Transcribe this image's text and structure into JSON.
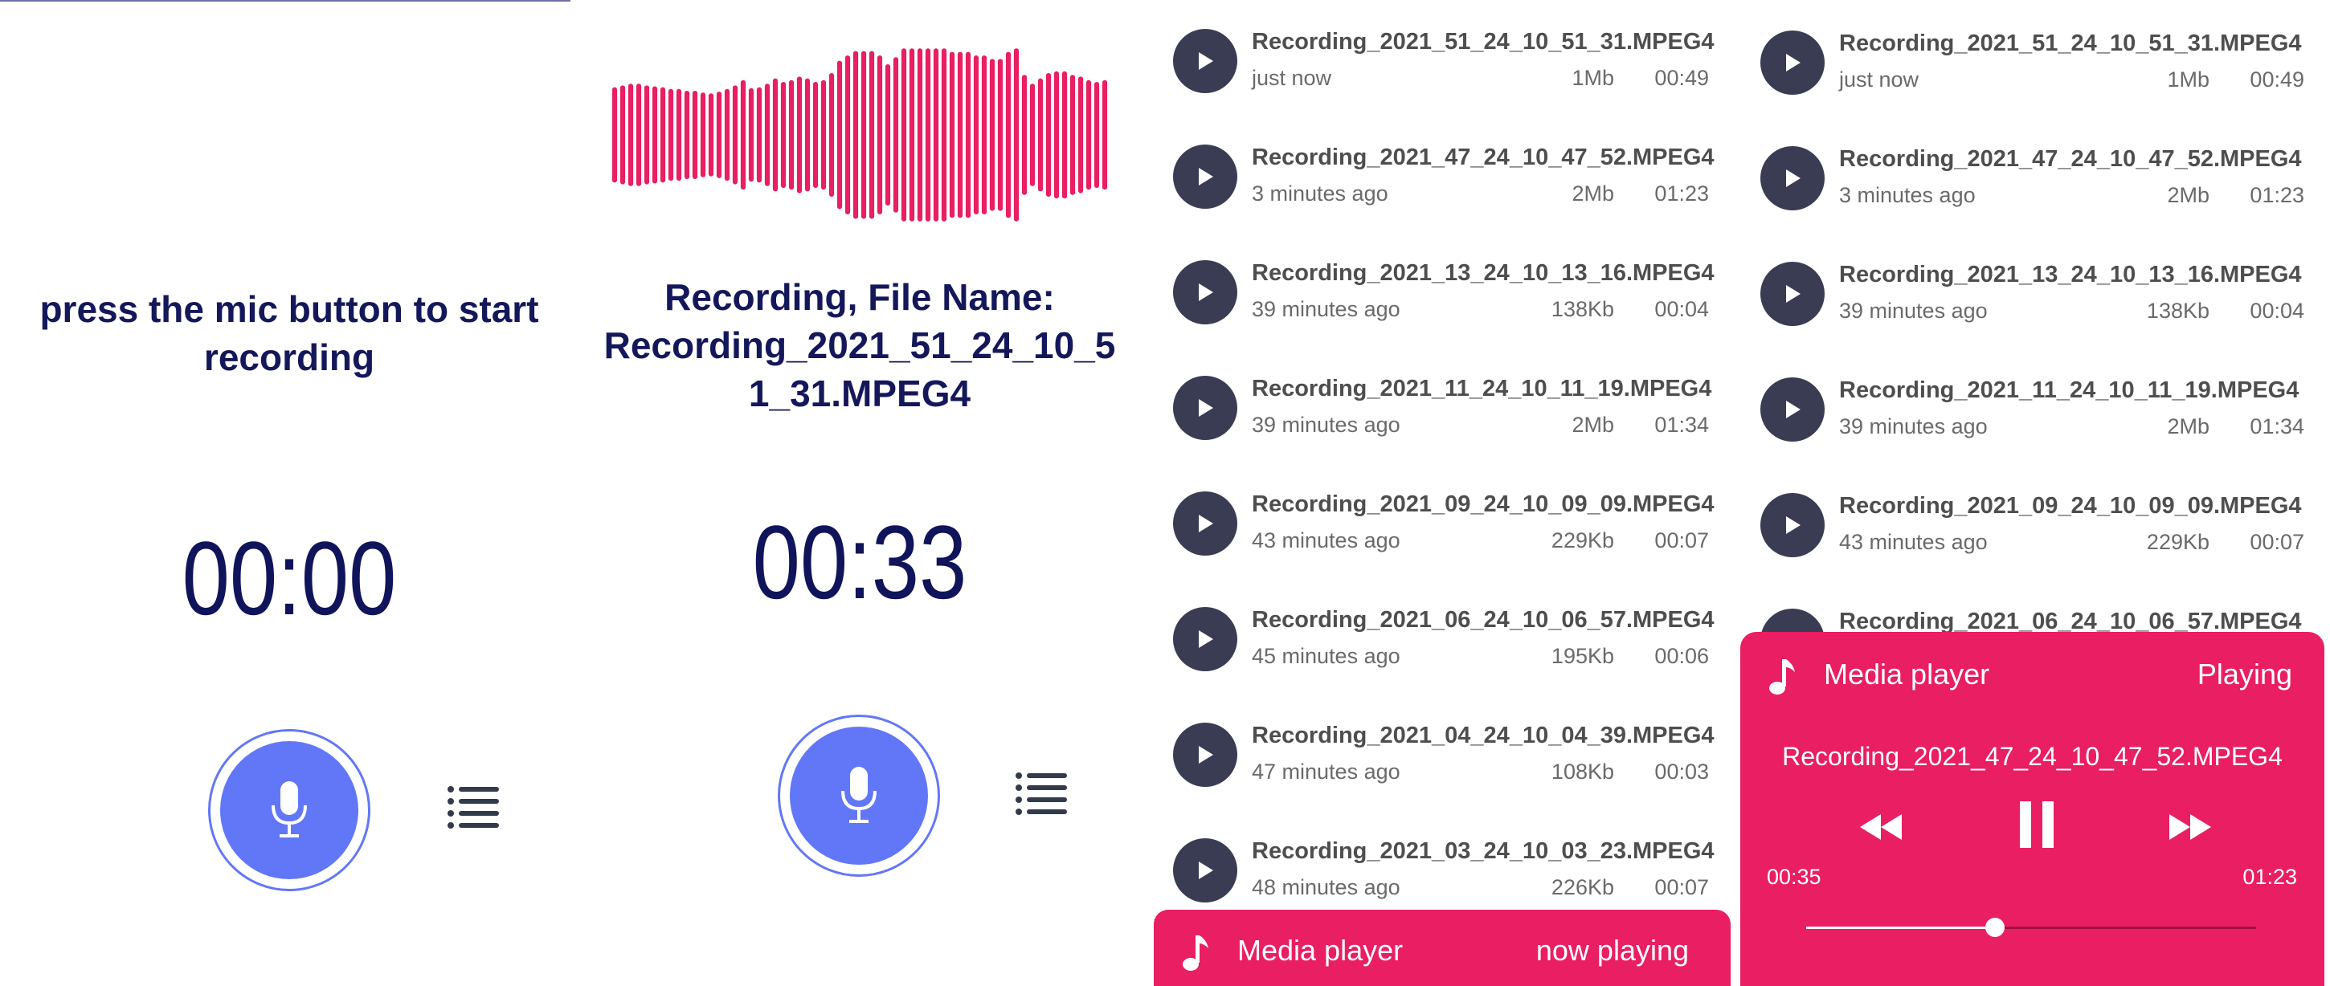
{
  "colors": {
    "accent_pink": "#e91e63",
    "mic_blue": "#6277f7",
    "title_navy": "#14185a",
    "play_button": "#3a3c54"
  },
  "idle_screen": {
    "prompt": "press the mic button to start recording",
    "timer": "00:00",
    "mic_icon": "mic-icon",
    "list_icon": "list-icon"
  },
  "recording_screen": {
    "status": "Recording, File Name: Recording_2021_51_24_10_5 1_31.MPEG4",
    "timer": "00:33",
    "waveform_levels": [
      0.54,
      0.56,
      0.58,
      0.58,
      0.56,
      0.55,
      0.54,
      0.52,
      0.52,
      0.5,
      0.5,
      0.48,
      0.47,
      0.49,
      0.52,
      0.56,
      0.62,
      0.53,
      0.54,
      0.58,
      0.64,
      0.6,
      0.62,
      0.66,
      0.64,
      0.6,
      0.62,
      0.7,
      0.84,
      0.9,
      0.95,
      0.95,
      0.95,
      0.9,
      0.8,
      0.88,
      0.98,
      0.98,
      0.98,
      0.98,
      0.98,
      0.98,
      0.94,
      0.94,
      0.94,
      0.9,
      0.9,
      0.86,
      0.86,
      0.94,
      0.98,
      0.68,
      0.58,
      0.64,
      0.7,
      0.72,
      0.72,
      0.68,
      0.66,
      0.62,
      0.6,
      0.62
    ],
    "list_icon": "list-icon"
  },
  "recordings": [
    {
      "name": "Recording_2021_51_24_10_51_31.MPEG4",
      "time": "just now",
      "size": "1Mb",
      "duration": "00:49"
    },
    {
      "name": "Recording_2021_47_24_10_47_52.MPEG4",
      "time": "3 minutes ago",
      "size": "2Mb",
      "duration": "01:23"
    },
    {
      "name": "Recording_2021_13_24_10_13_16.MPEG4",
      "time": "39 minutes ago",
      "size": "138Kb",
      "duration": "00:04"
    },
    {
      "name": "Recording_2021_11_24_10_11_19.MPEG4",
      "time": "39 minutes ago",
      "size": "2Mb",
      "duration": "01:34"
    },
    {
      "name": "Recording_2021_09_24_10_09_09.MPEG4",
      "time": "43 minutes ago",
      "size": "229Kb",
      "duration": "00:07"
    },
    {
      "name": "Recording_2021_06_24_10_06_57.MPEG4",
      "time": "45 minutes ago",
      "size": "195Kb",
      "duration": "00:06"
    },
    {
      "name": "Recording_2021_04_24_10_04_39.MPEG4",
      "time": "47 minutes ago",
      "size": "108Kb",
      "duration": "00:03"
    },
    {
      "name": "Recording_2021_03_24_10_03_23.MPEG4",
      "time": "48 minutes ago",
      "size": "226Kb",
      "duration": "00:07"
    }
  ],
  "list_screen_player": {
    "title": "Media player",
    "status": "now playing"
  },
  "expanded_player": {
    "title": "Media player",
    "status": "Playing",
    "file": "Recording_2021_47_24_10_47_52.MPEG4",
    "current_time": "00:35",
    "total_time": "01:23",
    "progress_fraction": 0.42
  }
}
